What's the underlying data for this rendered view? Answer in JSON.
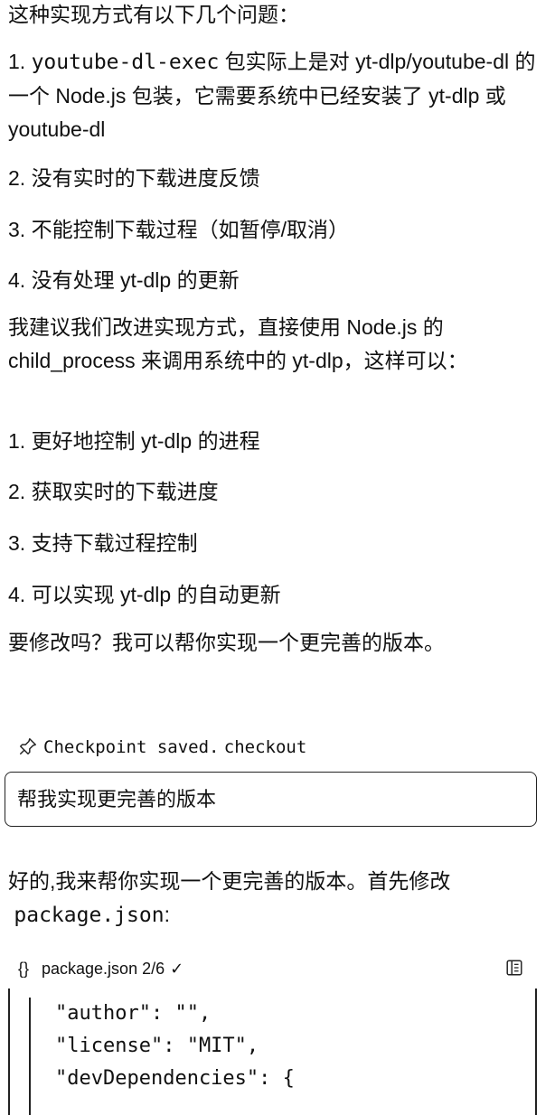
{
  "assistant_message_1": {
    "intro": "这种实现方式有以下几个问题：",
    "problems": [
      {
        "num": "1.",
        "code": "youtube-dl-exec",
        "text": " 包实际上是对 yt-dlp/youtube-dl 的一个 Node.js 包装，它需要系统中已经安装了 yt-dlp 或 youtube-dl"
      },
      {
        "text": "2. 没有实时的下载进度反馈"
      },
      {
        "text": "3. 不能控制下载过程（如暂停/取消）"
      },
      {
        "text": "4. 没有处理 yt-dlp 的更新"
      }
    ],
    "suggestion": "我建议我们改进实现方式，直接使用 Node.js 的 child_process 来调用系统中的 yt-dlp，这样可以：",
    "benefits": [
      "1. 更好地控制 yt-dlp 的进程",
      "2. 获取实时的下载进度",
      "3. 支持下载过程控制",
      "4. 可以实现 yt-dlp 的自动更新"
    ],
    "question": "要修改吗？我可以帮你实现一个更完善的版本。"
  },
  "checkpoint": {
    "icon": "pin-icon",
    "text": "Checkpoint saved.",
    "link": "checkout"
  },
  "user_message": "帮我实现更完善的版本",
  "assistant_message_2": {
    "text": "好的,我来帮你实现一个更完善的版本。首先修改",
    "code": "package.json",
    "colon": ":"
  },
  "code_block": {
    "icon": "braces-icon",
    "filename": "package.json",
    "progress": "2/6",
    "check": "✓",
    "lines": [
      "\"author\": \"\",",
      "\"license\": \"MIT\",",
      "\"devDependencies\": {"
    ]
  }
}
